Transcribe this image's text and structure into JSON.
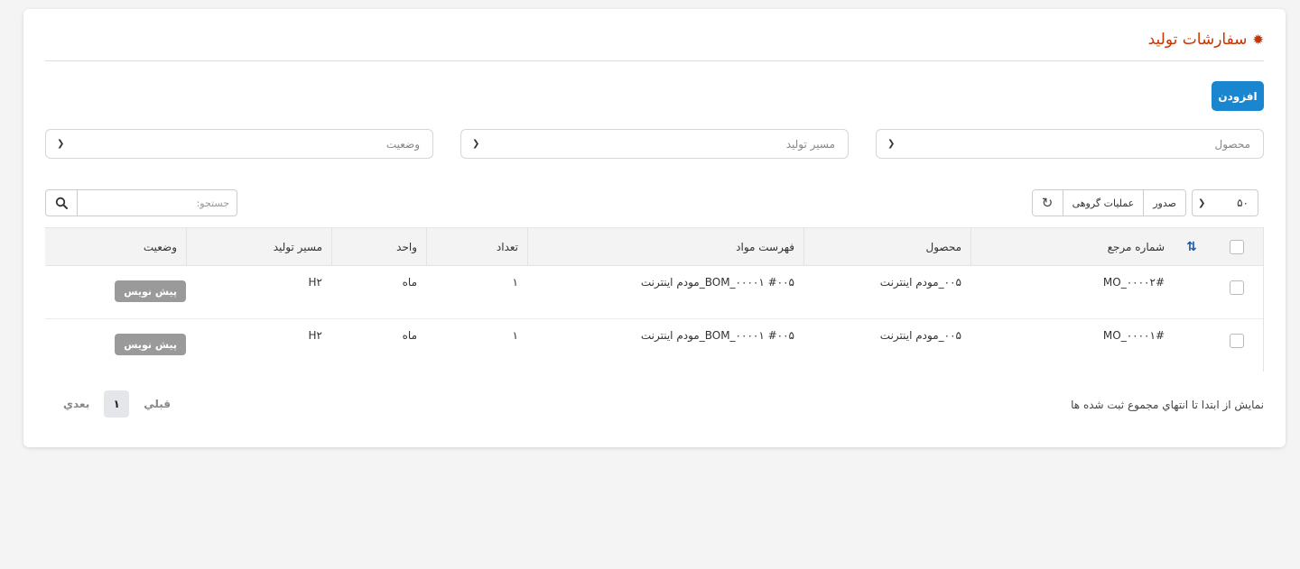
{
  "header": {
    "title": "سفارشات تولید",
    "icon": "gear-icon",
    "title_color": "#cc3300"
  },
  "actions": {
    "add_label": "افزودن",
    "accent": "#1a86d0"
  },
  "filters": [
    {
      "placeholder": "محصول"
    },
    {
      "placeholder": "مسیر تولید"
    },
    {
      "placeholder": "وضعیت"
    }
  ],
  "toolbar": {
    "page_size": "۵۰",
    "export_label": "صدور",
    "bulk_label": "عملیات گروهی",
    "refresh_icon": "refresh-icon"
  },
  "search": {
    "placeholder": "جستجو:",
    "value": ""
  },
  "table": {
    "columns": {
      "ref": "شماره مرجع",
      "product": "محصول",
      "bom": "فهرست مواد",
      "qty": "تعداد",
      "unit": "واحد",
      "route": "مسیر تولید",
      "status": "وضعیت"
    },
    "rows": [
      {
        "ref": "#MO_۰۰۰۰۲",
        "product": "۰۰۵_مودم اینترنت",
        "bom": "#۰۰۵ BOM_۰۰۰۰۱_مودم اینترنت",
        "qty": "۱",
        "unit": "ماه",
        "route": "H۲",
        "status": "پیش نویس"
      },
      {
        "ref": "#MO_۰۰۰۰۱",
        "product": "۰۰۵_مودم اینترنت",
        "bom": "#۰۰۵ BOM_۰۰۰۰۱_مودم اینترنت",
        "qty": "۱",
        "unit": "ماه",
        "route": "H۲",
        "status": "پیش نویس"
      }
    ]
  },
  "footer": {
    "info": "نمایش از ابتدا تا انتهاي مجموع ثبت شده ها",
    "prev_label": "قبلي",
    "current_page": "۱",
    "next_label": "بعدي"
  }
}
